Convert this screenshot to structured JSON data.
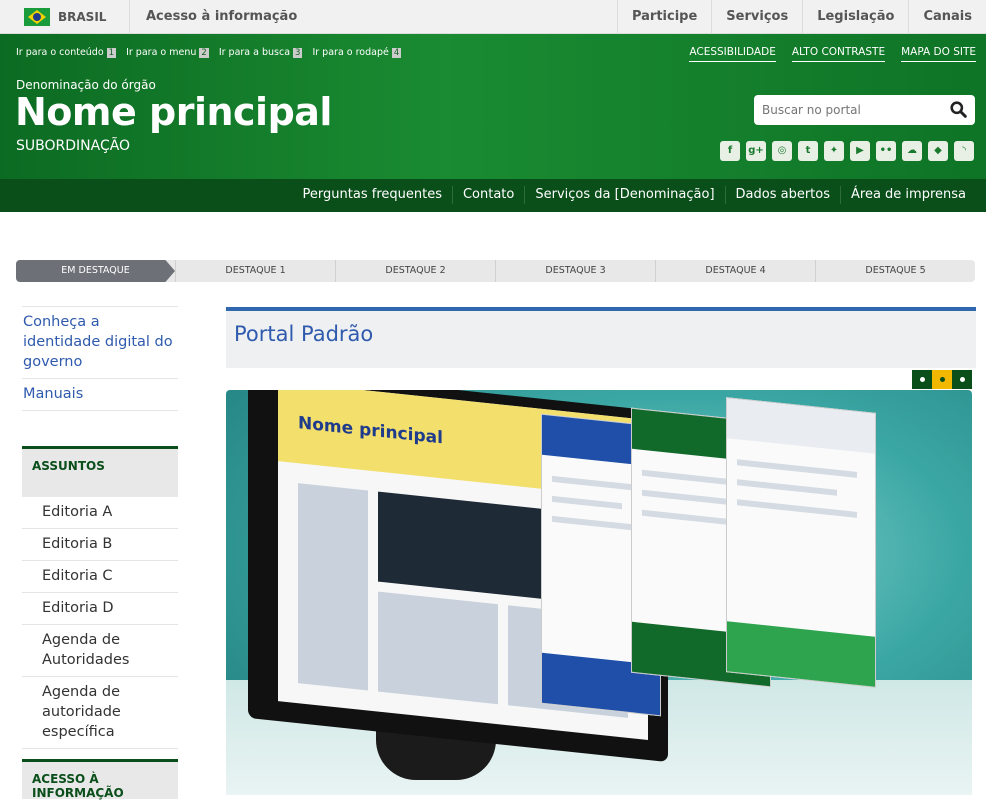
{
  "govbar": {
    "country": "BRASIL",
    "acesso": "Acesso à informação",
    "links": [
      "Participe",
      "Serviços",
      "Legislação",
      "Canais"
    ]
  },
  "header": {
    "skip_links": [
      {
        "label": "Ir para o conteúdo",
        "key": "1"
      },
      {
        "label": "Ir para o menu",
        "key": "2"
      },
      {
        "label": "Ir para a busca",
        "key": "3"
      },
      {
        "label": "Ir para o rodapé",
        "key": "4"
      }
    ],
    "top_links": [
      "ACESSIBILIDADE",
      "ALTO CONTRASTE",
      "MAPA DO SITE"
    ],
    "denominacao": "Denominação do órgão",
    "nome_principal": "Nome principal",
    "subordinacao": "SUBORDINAÇÃO",
    "search_placeholder": "Buscar no portal",
    "social_icons": [
      "facebook-icon",
      "google-plus-icon",
      "instagram-icon",
      "tumblr-icon",
      "twitter-icon",
      "youtube-icon",
      "flickr-icon",
      "soundcloud-icon",
      "slideshare-icon",
      "rss-icon"
    ]
  },
  "servnav": {
    "items": [
      "Perguntas frequentes",
      "Contato",
      "Serviços da [Denominação]",
      "Dados abertos",
      "Área de imprensa"
    ]
  },
  "destaque": {
    "tabs": [
      "EM DESTAQUE",
      "DESTAQUE 1",
      "DESTAQUE 2",
      "DESTAQUE 3",
      "DESTAQUE 4",
      "DESTAQUE 5"
    ],
    "active_index": 0
  },
  "sidebar": {
    "links": [
      "Conheça a identidade digital do governo",
      "Manuais"
    ],
    "section_title": "ASSUNTOS",
    "items": [
      "Editoria A",
      "Editoria B",
      "Editoria C",
      "Editoria D",
      "Agenda de Autoridades",
      "Agenda de autoridade específica"
    ],
    "section2_title": "ACESSO À INFORMAÇÃO"
  },
  "main": {
    "title": "Portal Padrão",
    "carousel_active": 1,
    "carousel_count": 3,
    "hero_screen_title": "Nome principal"
  },
  "colors": {
    "green_dark": "#0a4e1a",
    "green": "#1a8b32",
    "blue_link": "#2f5aad",
    "accent_yellow": "#f2b800"
  }
}
